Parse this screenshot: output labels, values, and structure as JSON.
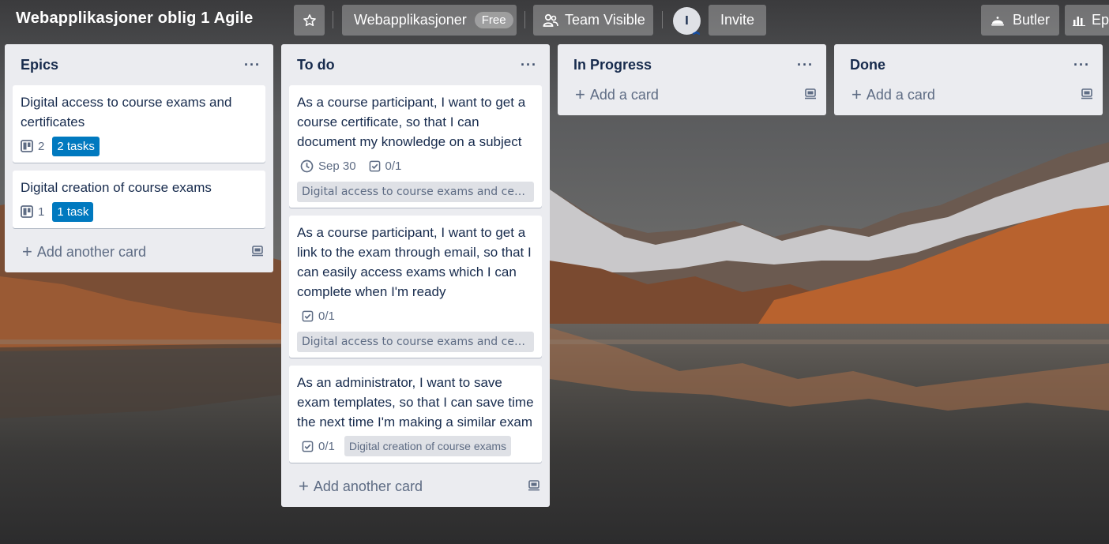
{
  "board": {
    "title": "Webapplikasjoner oblig 1 Agile",
    "workspace_label": "Webapplikasjoner",
    "plan_badge": "Free",
    "visibility_label": "Team Visible",
    "avatar_initial": "I",
    "invite_label": "Invite",
    "butler_label": "Butler",
    "power_up_label": "Ep"
  },
  "lists": [
    {
      "title": "Epics",
      "cards": [
        {
          "title": "Digital access to course exams and certificates",
          "linked_count": "2",
          "tasks_label": "2 tasks"
        },
        {
          "title": "Digital creation of course exams",
          "linked_count": "1",
          "tasks_label": "1 task"
        }
      ],
      "add_label": "Add another card"
    },
    {
      "title": "To do",
      "cards": [
        {
          "title": "As a course participant, I want to get a course certificate, so that I can document my knowledge on a subject",
          "due": "Sep 30",
          "checklist": "0/1",
          "epic": "Digital access to course exams and certificates"
        },
        {
          "title": "As a course participant, I want to get a link to the exam through email, so that I can easily access exams which I can complete when I'm ready",
          "checklist": "0/1",
          "epic": "Digital access to course exams and certificates"
        },
        {
          "title": "As an administrator, I want to save exam templates, so that I can save time the next time I'm making a similar exam",
          "checklist": "0/1",
          "epic": "Digital creation of course exams"
        }
      ],
      "add_label": "Add another card"
    },
    {
      "title": "In Progress",
      "cards": [],
      "add_label": "Add a card"
    },
    {
      "title": "Done",
      "cards": [],
      "add_label": "Add a card"
    }
  ],
  "colors": {
    "list_bg": "#ebecf0",
    "task_chip": "#0079bf",
    "text": "#172b4d",
    "muted": "#5e6c84"
  }
}
